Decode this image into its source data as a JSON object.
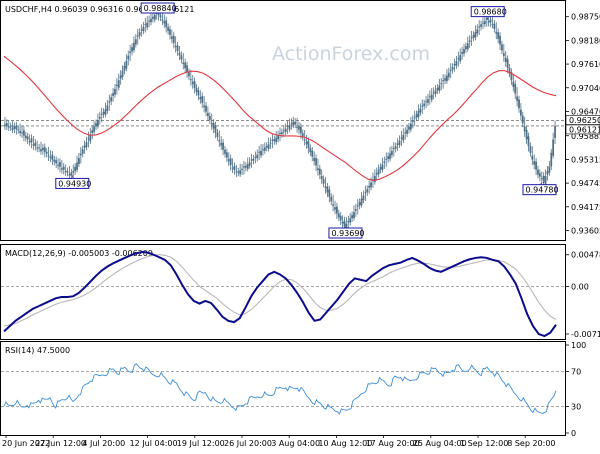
{
  "watermark": "ActionForex.com",
  "chart_data": [
    {
      "type": "line",
      "panel": "price",
      "header": "USDCHF,H4 0.96039 0.96316 0.96030 0.96121",
      "symbol": "USDCHF,H4",
      "ohlc": {
        "open": 0.96039,
        "high": 0.96316,
        "low": 0.9603,
        "close": 0.96121
      },
      "ylim": [
        0.934,
        0.9908
      ],
      "yticks": [
        "0.98750",
        "0.98180",
        "0.97610",
        "0.97040",
        "0.96470",
        "0.95885",
        "0.95315",
        "0.94745",
        "0.94175",
        "0.93605"
      ],
      "xticks": [
        "20 Jun 2022",
        "27 Jun 12:00",
        "4 Jul 20:00",
        "12 Jul 04:00",
        "19 Jul 12:00",
        "26 Jul 20:00",
        "3 Aug 04:00",
        "10 Aug 12:00",
        "17 Aug 20:00",
        "25 Aug 04:00",
        "1 Sep 12:00",
        "8 Sep 20:00"
      ],
      "price_series": [
        0.9618,
        0.9611,
        0.9606,
        0.96,
        0.9583,
        0.9572,
        0.956,
        0.9554,
        0.9541,
        0.9526,
        0.9514,
        0.9503,
        0.9493,
        0.9524,
        0.9556,
        0.9582,
        0.9611,
        0.9634,
        0.9652,
        0.9681,
        0.9711,
        0.9745,
        0.9781,
        0.9812,
        0.9838,
        0.9856,
        0.987,
        0.9884,
        0.9868,
        0.9841,
        0.9812,
        0.9782,
        0.9751,
        0.9722,
        0.9694,
        0.9668,
        0.9636,
        0.9606,
        0.9575,
        0.9545,
        0.9518,
        0.95,
        0.9508,
        0.952,
        0.9533,
        0.9548,
        0.956,
        0.9572,
        0.9584,
        0.9597,
        0.961,
        0.9622,
        0.9603,
        0.9578,
        0.9549,
        0.9517,
        0.9484,
        0.9452,
        0.942,
        0.9392,
        0.937,
        0.939,
        0.9412,
        0.9437,
        0.946,
        0.9484,
        0.9507,
        0.9526,
        0.9546,
        0.9563,
        0.9584,
        0.9603,
        0.9625,
        0.9648,
        0.9666,
        0.9682,
        0.9698,
        0.9715,
        0.9733,
        0.9754,
        0.9775,
        0.9797,
        0.9818,
        0.9838,
        0.9857,
        0.9868,
        0.9858,
        0.9822,
        0.978,
        0.9738,
        0.969,
        0.9637,
        0.958,
        0.9531,
        0.9495,
        0.948,
        0.9515,
        0.9612
      ],
      "ma_series": [
        0.978,
        0.9769,
        0.9758,
        0.9746,
        0.9733,
        0.9719,
        0.9704,
        0.9688,
        0.9672,
        0.9656,
        0.9641,
        0.9627,
        0.9614,
        0.9603,
        0.9595,
        0.959,
        0.959,
        0.9594,
        0.9601,
        0.961,
        0.962,
        0.9632,
        0.9645,
        0.9659,
        0.9672,
        0.9684,
        0.9695,
        0.9705,
        0.9713,
        0.9721,
        0.9729,
        0.9736,
        0.9741,
        0.9744,
        0.9743,
        0.9739,
        0.9731,
        0.9721,
        0.9709,
        0.9695,
        0.9681,
        0.9666,
        0.965,
        0.9636,
        0.9625,
        0.9613,
        0.9602,
        0.9594,
        0.959,
        0.9588,
        0.9588,
        0.9588,
        0.9587,
        0.9584,
        0.9578,
        0.957,
        0.956,
        0.9551,
        0.9542,
        0.9533,
        0.9524,
        0.9513,
        0.9502,
        0.9492,
        0.9484,
        0.9481,
        0.9484,
        0.949,
        0.9497,
        0.9505,
        0.9515,
        0.9527,
        0.954,
        0.9554,
        0.957,
        0.9586,
        0.9601,
        0.9615,
        0.9628,
        0.964,
        0.9654,
        0.9669,
        0.9685,
        0.97,
        0.9716,
        0.973,
        0.974,
        0.9745,
        0.9745,
        0.974,
        0.9732,
        0.9723,
        0.9714,
        0.9705,
        0.9698,
        0.9692,
        0.9688,
        0.9685
      ],
      "callouts": [
        {
          "label": "0.94930",
          "index": 12,
          "value": 0.9493,
          "side": "below"
        },
        {
          "label": "0.98840",
          "index": 27,
          "value": 0.9884,
          "side": "above"
        },
        {
          "label": "0.93690",
          "index": 60,
          "value": 0.9369,
          "side": "below"
        },
        {
          "label": "0.98680",
          "index": 85,
          "value": 0.9868,
          "side": "above"
        },
        {
          "label": "0.94780",
          "index": 95,
          "value": 0.9478,
          "side": "below"
        }
      ],
      "reference_lines": [
        {
          "label": "0.96250",
          "value": 0.9625
        },
        {
          "label": "0.96121",
          "value": 0.96121
        }
      ],
      "colors": {
        "candles": "#4f6f86",
        "ma": "#e0373e",
        "callout": "#1a1aa8"
      }
    },
    {
      "type": "line",
      "panel": "macd",
      "header": "MACD(12,26,9) -0.005003 -0.006209",
      "ylim": [
        -0.0078,
        0.0058
      ],
      "yticks": [
        "0.004781",
        "0.00",
        "-0.007191"
      ],
      "macd_series": [
        -0.0068,
        -0.006,
        -0.0052,
        -0.0046,
        -0.004,
        -0.0034,
        -0.003,
        -0.0026,
        -0.0022,
        -0.0018,
        -0.0016,
        -0.0016,
        -0.0015,
        -0.001,
        -0.0002,
        0.0007,
        0.0016,
        0.0024,
        0.003,
        0.0035,
        0.0039,
        0.0043,
        0.0047,
        0.005,
        0.0052,
        0.0051,
        0.0048,
        0.0044,
        0.004,
        0.0032,
        0.0018,
        0.0002,
        -0.0012,
        -0.0022,
        -0.0026,
        -0.0022,
        -0.0025,
        -0.0035,
        -0.0046,
        -0.0052,
        -0.0054,
        -0.0048,
        -0.0032,
        -0.0015,
        -0.0002,
        0.0008,
        0.0018,
        0.0022,
        0.0018,
        0.0012,
        0.0002,
        -0.001,
        -0.0024,
        -0.004,
        -0.0052,
        -0.005,
        -0.004,
        -0.003,
        -0.002,
        -0.0008,
        0.0004,
        0.0012,
        0.001,
        0.0008,
        0.0016,
        0.0022,
        0.0028,
        0.0032,
        0.0034,
        0.0036,
        0.004,
        0.0043,
        0.0039,
        0.0034,
        0.0028,
        0.0024,
        0.0022,
        0.0026,
        0.003,
        0.0034,
        0.0038,
        0.0041,
        0.0043,
        0.0044,
        0.0043,
        0.004,
        0.0038,
        0.003,
        0.0018,
        0.0004,
        -0.0018,
        -0.0042,
        -0.006,
        -0.0072,
        -0.0075,
        -0.007,
        -0.0058
      ],
      "signal_series": [
        -0.006,
        -0.0058,
        -0.0056,
        -0.0052,
        -0.0048,
        -0.0043,
        -0.0039,
        -0.0035,
        -0.0031,
        -0.0027,
        -0.0024,
        -0.0022,
        -0.002,
        -0.0017,
        -0.0013,
        -0.0008,
        -0.0002,
        0.0005,
        0.0012,
        0.0018,
        0.0024,
        0.0029,
        0.0034,
        0.0038,
        0.0042,
        0.0045,
        0.0047,
        0.0048,
        0.0047,
        0.0044,
        0.0038,
        0.0029,
        0.0019,
        0.0009,
        0.0,
        -0.0006,
        -0.0012,
        -0.0018,
        -0.0026,
        -0.0033,
        -0.0039,
        -0.0043,
        -0.0041,
        -0.0035,
        -0.0027,
        -0.0018,
        -0.0009,
        0.0,
        0.0007,
        0.0011,
        0.001,
        0.0005,
        -0.0003,
        -0.0013,
        -0.0024,
        -0.0032,
        -0.0036,
        -0.0036,
        -0.0033,
        -0.0027,
        -0.0019,
        -0.001,
        -0.0003,
        0.0003,
        0.0007,
        0.0011,
        0.0015,
        0.002,
        0.0024,
        0.0027,
        0.003,
        0.0033,
        0.0035,
        0.0035,
        0.0034,
        0.0032,
        0.003,
        0.0029,
        0.0029,
        0.003,
        0.0032,
        0.0034,
        0.0036,
        0.0038,
        0.004,
        0.004,
        0.0039,
        0.0037,
        0.0032,
        0.0026,
        0.0016,
        0.0004,
        -0.001,
        -0.0024,
        -0.0036,
        -0.0045,
        -0.005
      ],
      "colors": {
        "macd": "#0a0a8c",
        "signal": "#b8b8b8"
      }
    },
    {
      "type": "line",
      "panel": "rsi",
      "header": "RSI(14) 47.5000",
      "ylim": [
        0,
        100
      ],
      "yticks": [
        "100",
        "70",
        "30",
        "0"
      ],
      "levels": [
        70,
        30
      ],
      "rsi_series": [
        34,
        30,
        36,
        28,
        33,
        31,
        38,
        35,
        40,
        32,
        37,
        42,
        34,
        45,
        52,
        60,
        63,
        66,
        70,
        72,
        69,
        73,
        71,
        76,
        74,
        70,
        66,
        68,
        62,
        58,
        55,
        48,
        42,
        38,
        44,
        46,
        40,
        35,
        37,
        33,
        30,
        28,
        34,
        38,
        41,
        45,
        42,
        47,
        50,
        53,
        49,
        52,
        46,
        40,
        36,
        33,
        30,
        27,
        26,
        24,
        28,
        35,
        44,
        52,
        56,
        60,
        58,
        55,
        62,
        64,
        58,
        60,
        66,
        68,
        70,
        72,
        69,
        66,
        72,
        74,
        70,
        76,
        71,
        68,
        73,
        70,
        64,
        58,
        50,
        44,
        40,
        32,
        26,
        22,
        25,
        34,
        48
      ],
      "colors": {
        "rsi": "#3d8fd6",
        "levels": "#8a8a8a"
      }
    }
  ]
}
